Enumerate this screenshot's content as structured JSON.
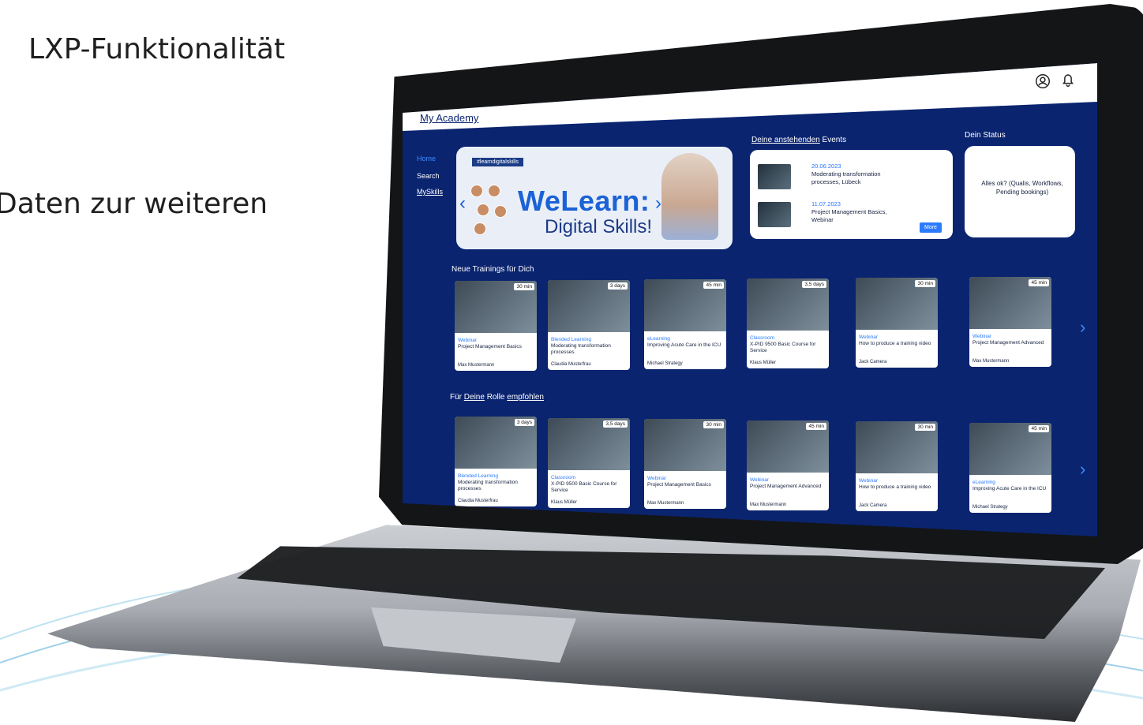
{
  "slide": {
    "title": "LXP-Funktionalität",
    "line": "Daten zur weiteren"
  },
  "app": {
    "brand": "My Academy",
    "nav": [
      "Home",
      "Search",
      "MySkills"
    ],
    "hero": {
      "tag": "#learndigitalskills",
      "title": "WeLearn:",
      "subtitle": "Digital Skills!"
    },
    "events": {
      "heading_prefix": "Deine anstehenden",
      "heading_suffix": "Events",
      "items": [
        {
          "date": "20.06.2023",
          "text": "Moderating transformation processes, Lübeck"
        },
        {
          "date": "11.07.2023",
          "text": "Project Management Basics, Webinar"
        }
      ],
      "more": "More"
    },
    "status": {
      "heading": "Dein Status",
      "text": "Alles ok? (Qualis, Workflows, Pending bookings)"
    },
    "new_trainings": {
      "heading": "Neue Trainings für Dich",
      "cards": [
        {
          "duration": "30 min",
          "type": "Webinar",
          "title": "Project Management Basics",
          "person": "Max Mustermann"
        },
        {
          "duration": "3 days",
          "type": "Blended Learning",
          "title": "Moderating transformation processes",
          "person": "Claudia Musterfrau"
        },
        {
          "duration": "45 min",
          "type": "eLearning",
          "title": "Improving Acute Care in the ICU",
          "person": "Michael Strategy"
        },
        {
          "duration": "3,5 days",
          "type": "Classroom",
          "title": "X-PID 9500 Basic Course for Service",
          "person": "Klaus Müller"
        },
        {
          "duration": "30 min",
          "type": "Webinar",
          "title": "How to produce a training video",
          "person": "Jack Camera"
        },
        {
          "duration": "45 min",
          "type": "Webinar",
          "title": "Project Management Advanced",
          "person": "Max Mustermann"
        }
      ]
    },
    "role_recommended": {
      "heading_prefix": "Für",
      "heading_u1": "Deine",
      "heading_mid": "Rolle",
      "heading_u2": "empfohlen",
      "cards": [
        {
          "duration": "3 days",
          "type": "Blended Learning",
          "title": "Moderating transformation processes",
          "person": "Claudia Musterfrau"
        },
        {
          "duration": "3,5 days",
          "type": "Classroom",
          "title": "X-PID 9500 Basic Course for Service",
          "person": "Klaus Müller"
        },
        {
          "duration": "30 min",
          "type": "Webinar",
          "title": "Project Management Basics",
          "person": "Max Mustermann"
        },
        {
          "duration": "45 min",
          "type": "Webinar",
          "title": "Project Management Advanced",
          "person": "Max Mustermann"
        },
        {
          "duration": "30 min",
          "type": "Webinar",
          "title": "How to produce a training video",
          "person": "Jack Camera"
        },
        {
          "duration": "45 min",
          "type": "eLearning",
          "title": "Improving Acute Care in the ICU",
          "person": "Michael Strategy"
        }
      ]
    },
    "colors": {
      "screen_bg": "#0a2470",
      "accent": "#2b7bff"
    },
    "icons": [
      "user-icon",
      "bell-icon",
      "chevron-right-icon",
      "chevron-left-icon"
    ]
  }
}
